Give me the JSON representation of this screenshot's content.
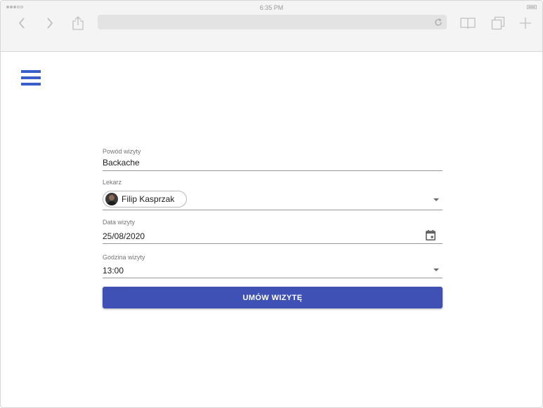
{
  "status_bar": {
    "time": "6:35 PM"
  },
  "browser": {
    "icons": [
      "back-icon",
      "forward-icon",
      "share-icon",
      "reload-icon",
      "bookmarks-icon",
      "tabs-icon",
      "new-tab-icon"
    ]
  },
  "menu": {
    "icon": "hamburger-menu-icon"
  },
  "form": {
    "reason": {
      "label": "Powód wizyty",
      "value": "Backache"
    },
    "doctor": {
      "label": "Lekarz",
      "value": "Filip Kasprzak"
    },
    "date": {
      "label": "Data wizyty",
      "value": "25/08/2020"
    },
    "time": {
      "label": "Godzina wizyty",
      "value": "13:00"
    },
    "submit_label": "UMÓW WIZYTĘ"
  },
  "colors": {
    "primary": "#3f51b5",
    "menu": "#3b5fc8",
    "chrome": "#f4f4f4"
  }
}
